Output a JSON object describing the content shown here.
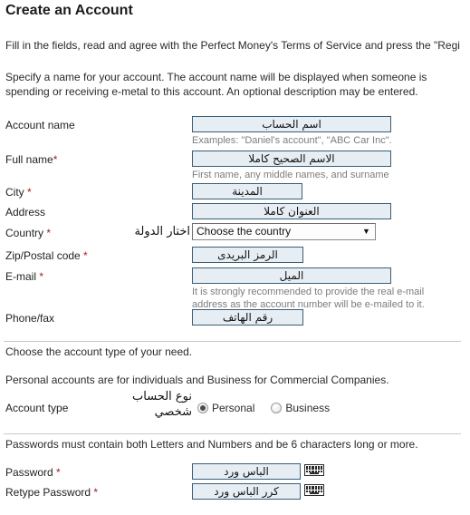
{
  "page": {
    "title": "Create an Account",
    "intro": "Fill in the fields, read and agree with the Perfect Money's Terms of Service and press the \"Regi"
  },
  "sections": {
    "account_info_note_line1": "Specify a name for your account. The account name will be displayed when someone is",
    "account_info_note_line2": "spending or receiving e-metal to this account. An optional description may be entered.",
    "account_type_note": "Choose the account type of your need.",
    "account_type_desc": "Personal accounts are for individuals and Business for Commercial Companies.",
    "password_note": "Passwords must contain both Letters and Numbers and be 6 characters long or more."
  },
  "fields": {
    "account_name": {
      "label": "Account name",
      "required": false,
      "value": "اسم الحساب",
      "hint": "Examples: \"Daniel's account\", \"ABC Car Inc\"."
    },
    "full_name": {
      "label": "Full name",
      "required": true,
      "value": "الاسم الصحيح كاملا",
      "hint": "First name, any middle names, and surname"
    },
    "city": {
      "label": "City ",
      "required": true,
      "value": "المدينة"
    },
    "address": {
      "label": "Address",
      "required": false,
      "value": "العنوان كاملا"
    },
    "country": {
      "label": "Country ",
      "required": true,
      "selected": "Choose the country",
      "annotation": "اختار الدولة",
      "arrow": "▼"
    },
    "zip": {
      "label": "Zip/Postal code ",
      "required": true,
      "value": "الرمز البريدى"
    },
    "email": {
      "label": "E-mail ",
      "required": true,
      "value": "الميل",
      "hint_line1": "It is strongly recommended to provide the real e-mail",
      "hint_line2": "address as the account number will be e-mailed to it."
    },
    "phone": {
      "label": "Phone/fax",
      "required": false,
      "value": "رقم الهاتف"
    },
    "account_type": {
      "label": "Account type",
      "annotation_line1": "نوع الحساب",
      "annotation_line2": "شخصي",
      "options": [
        {
          "label": "Personal",
          "selected": true
        },
        {
          "label": "Business",
          "selected": false
        }
      ]
    },
    "password": {
      "label": "Password ",
      "required": true,
      "value": "الباس ورد"
    },
    "retype_password": {
      "label": "Retype Password ",
      "required": true,
      "value": "كرر الباس ورد"
    }
  },
  "icons": {
    "virtual_keyboard": "keyboard-icon",
    "required_marker": "*"
  },
  "colors": {
    "field_border": "#3b5e77",
    "field_background": "#e6eef4",
    "required_asterisk": "#a32020",
    "hint_text": "#7d7d7d",
    "divider": "#c9c9c9"
  }
}
